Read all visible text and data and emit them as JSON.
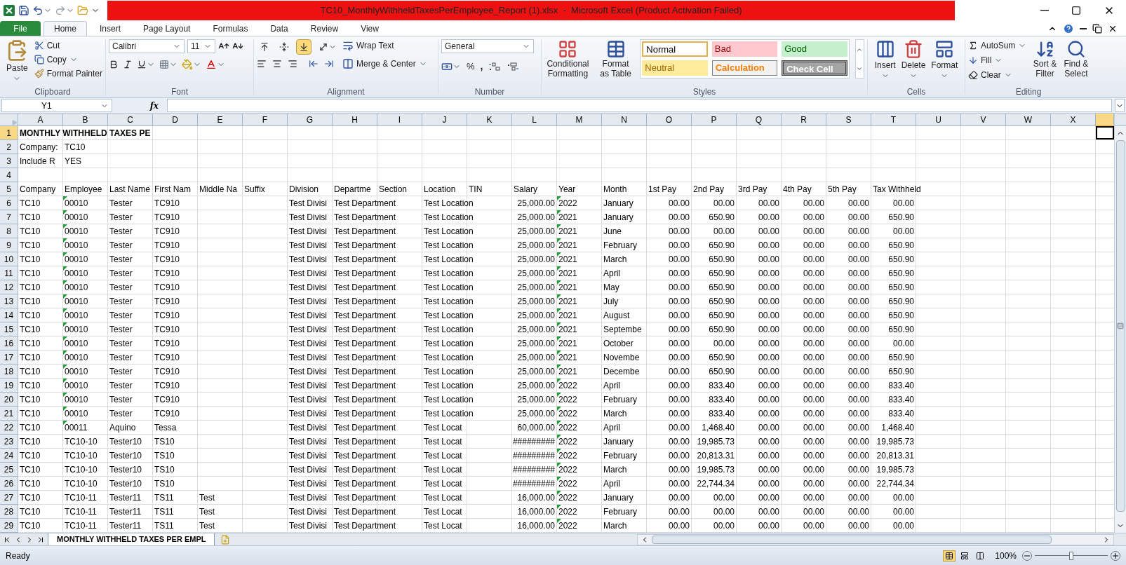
{
  "window": {
    "title": "TC10_MonthlyWithheldTaxesPerEmployee_Report (1).xlsx  -  Microsoft Excel (Product Activation Failed)"
  },
  "tabs": [
    {
      "label": "File",
      "kind": "file",
      "selected": false
    },
    {
      "label": "Home",
      "kind": "tab",
      "selected": true
    },
    {
      "label": "Insert",
      "kind": "tab",
      "selected": false
    },
    {
      "label": "Page Layout",
      "kind": "tab",
      "selected": false
    },
    {
      "label": "Formulas",
      "kind": "tab",
      "selected": false
    },
    {
      "label": "Data",
      "kind": "tab",
      "selected": false
    },
    {
      "label": "Review",
      "kind": "tab",
      "selected": false
    },
    {
      "label": "View",
      "kind": "tab",
      "selected": false
    }
  ],
  "ribbon": {
    "clipboard": {
      "label": "Clipboard",
      "paste": "Paste",
      "cut": "Cut",
      "copy": "Copy",
      "format_painter": "Format Painter"
    },
    "font": {
      "label": "Font",
      "font_name": "Calibri",
      "font_size": "11"
    },
    "alignment": {
      "label": "Alignment",
      "wrap_text": "Wrap Text",
      "merge_center": "Merge & Center",
      "vertical_align": [
        {
          "selected": false
        },
        {
          "selected": false
        },
        {
          "selected": true
        }
      ]
    },
    "number": {
      "label": "Number",
      "format": "General",
      "percent": "%",
      "comma": ","
    },
    "styles": {
      "label": "Styles",
      "conditional_formatting": "Conditional Formatting",
      "format_as_table": "Format as Table",
      "cell_styles": [
        {
          "label": "Normal",
          "kind": "normal"
        },
        {
          "label": "Bad",
          "kind": "bad"
        },
        {
          "label": "Good",
          "kind": "good"
        },
        {
          "label": "Neutral",
          "kind": "neutral"
        },
        {
          "label": "Calculation",
          "kind": "calculation"
        },
        {
          "label": "Check Cell",
          "kind": "check"
        }
      ]
    },
    "cells": {
      "label": "Cells",
      "insert": "Insert",
      "delete": "Delete",
      "format": "Format"
    },
    "editing": {
      "label": "Editing",
      "autosum": "AutoSum",
      "fill": "Fill",
      "clear": "Clear",
      "sort_filter": "Sort & Filter",
      "find_select": "Find & Select"
    }
  },
  "formula_bar": {
    "name_box": "Y1",
    "function_symbol": "fx"
  },
  "sheet": {
    "columns": [
      {
        "label": "A",
        "selected": false
      },
      {
        "label": "B",
        "selected": false
      },
      {
        "label": "C",
        "selected": false
      },
      {
        "label": "D",
        "selected": false
      },
      {
        "label": "E",
        "selected": false
      },
      {
        "label": "F",
        "selected": false
      },
      {
        "label": "G",
        "selected": false
      },
      {
        "label": "H",
        "selected": false
      },
      {
        "label": "I",
        "selected": false
      },
      {
        "label": "J",
        "selected": false
      },
      {
        "label": "K",
        "selected": false
      },
      {
        "label": "L",
        "selected": false
      },
      {
        "label": "M",
        "selected": false
      },
      {
        "label": "N",
        "selected": false
      },
      {
        "label": "O",
        "selected": false
      },
      {
        "label": "P",
        "selected": false
      },
      {
        "label": "Q",
        "selected": false
      },
      {
        "label": "R",
        "selected": false
      },
      {
        "label": "S",
        "selected": false
      },
      {
        "label": "T",
        "selected": false
      },
      {
        "label": "U",
        "selected": false
      },
      {
        "label": "V",
        "selected": false
      },
      {
        "label": "W",
        "selected": false
      },
      {
        "label": "X",
        "selected": false
      },
      {
        "selected": true
      }
    ],
    "rows": [
      {
        "number": "1",
        "kind": "title",
        "selected": true,
        "cells": [
          "MONTHLY WITHHELD TAXES PE"
        ]
      },
      {
        "number": "2",
        "kind": "info",
        "selected": false,
        "cells": [
          "Company:",
          "TC10"
        ]
      },
      {
        "number": "3",
        "kind": "info",
        "selected": false,
        "cells": [
          "Include R",
          "YES"
        ]
      },
      {
        "number": "4",
        "kind": "blank",
        "selected": false
      },
      {
        "number": "5",
        "kind": "header",
        "selected": false,
        "cells": [
          "Company",
          "Employee",
          "Last Name",
          "First Nam",
          "Middle Na",
          "Suffix",
          "Division",
          "Departme",
          "Section",
          "Location",
          "TIN",
          "Salary",
          "Year",
          "Month",
          "1st Pay",
          "2nd Pay",
          "3rd Pay",
          "4th Pay",
          "5th Pay",
          "Tax Withheld"
        ]
      },
      {
        "number": "6",
        "kind": "data",
        "selected": false,
        "cells": [
          "TC10",
          {
            "text": "00010",
            "warning": true
          },
          "Tester",
          "TC910",
          null,
          null,
          "Test Divisi",
          "Test Department",
          null,
          "Test Location",
          null,
          "25,000.00",
          {
            "text": "2022",
            "warning": true
          },
          "January",
          "00.00",
          "00.00",
          "00.00",
          "00.00",
          "00.00",
          "00.00"
        ]
      },
      {
        "number": "7",
        "kind": "data",
        "selected": false,
        "cells": [
          "TC10",
          {
            "text": "00010",
            "warning": true
          },
          "Tester",
          "TC910",
          null,
          null,
          "Test Divisi",
          "Test Department",
          null,
          "Test Location",
          null,
          "25,000.00",
          {
            "text": "2021",
            "warning": true
          },
          "January",
          "00.00",
          "650.90",
          "00.00",
          "00.00",
          "00.00",
          "650.90"
        ]
      },
      {
        "number": "8",
        "kind": "data",
        "selected": false,
        "cells": [
          "TC10",
          {
            "text": "00010",
            "warning": true
          },
          "Tester",
          "TC910",
          null,
          null,
          "Test Divisi",
          "Test Department",
          null,
          "Test Location",
          null,
          "25,000.00",
          {
            "text": "2021",
            "warning": true
          },
          "June",
          "00.00",
          "00.00",
          "00.00",
          "00.00",
          "00.00",
          "00.00"
        ]
      },
      {
        "number": "9",
        "kind": "data",
        "selected": false,
        "cells": [
          "TC10",
          {
            "text": "00010",
            "warning": true
          },
          "Tester",
          "TC910",
          null,
          null,
          "Test Divisi",
          "Test Department",
          null,
          "Test Location",
          null,
          "25,000.00",
          {
            "text": "2021",
            "warning": true
          },
          "February",
          "00.00",
          "650.90",
          "00.00",
          "00.00",
          "00.00",
          "650.90"
        ]
      },
      {
        "number": "10",
        "kind": "data",
        "selected": false,
        "cells": [
          "TC10",
          {
            "text": "00010",
            "warning": true
          },
          "Tester",
          "TC910",
          null,
          null,
          "Test Divisi",
          "Test Department",
          null,
          "Test Location",
          null,
          "25,000.00",
          {
            "text": "2021",
            "warning": true
          },
          "March",
          "00.00",
          "650.90",
          "00.00",
          "00.00",
          "00.00",
          "650.90"
        ]
      },
      {
        "number": "11",
        "kind": "data",
        "selected": false,
        "cells": [
          "TC10",
          {
            "text": "00010",
            "warning": true
          },
          "Tester",
          "TC910",
          null,
          null,
          "Test Divisi",
          "Test Department",
          null,
          "Test Location",
          null,
          "25,000.00",
          {
            "text": "2021",
            "warning": true
          },
          "April",
          "00.00",
          "650.90",
          "00.00",
          "00.00",
          "00.00",
          "650.90"
        ]
      },
      {
        "number": "12",
        "kind": "data",
        "selected": false,
        "cells": [
          "TC10",
          {
            "text": "00010",
            "warning": true
          },
          "Tester",
          "TC910",
          null,
          null,
          "Test Divisi",
          "Test Department",
          null,
          "Test Location",
          null,
          "25,000.00",
          {
            "text": "2021",
            "warning": true
          },
          "May",
          "00.00",
          "650.90",
          "00.00",
          "00.00",
          "00.00",
          "650.90"
        ]
      },
      {
        "number": "13",
        "kind": "data",
        "selected": false,
        "cells": [
          "TC10",
          {
            "text": "00010",
            "warning": true
          },
          "Tester",
          "TC910",
          null,
          null,
          "Test Divisi",
          "Test Department",
          null,
          "Test Location",
          null,
          "25,000.00",
          {
            "text": "2021",
            "warning": true
          },
          "July",
          "00.00",
          "650.90",
          "00.00",
          "00.00",
          "00.00",
          "650.90"
        ]
      },
      {
        "number": "14",
        "kind": "data",
        "selected": false,
        "cells": [
          "TC10",
          {
            "text": "00010",
            "warning": true
          },
          "Tester",
          "TC910",
          null,
          null,
          "Test Divisi",
          "Test Department",
          null,
          "Test Location",
          null,
          "25,000.00",
          {
            "text": "2021",
            "warning": true
          },
          "August",
          "00.00",
          "650.90",
          "00.00",
          "00.00",
          "00.00",
          "650.90"
        ]
      },
      {
        "number": "15",
        "kind": "data",
        "selected": false,
        "cells": [
          "TC10",
          {
            "text": "00010",
            "warning": true
          },
          "Tester",
          "TC910",
          null,
          null,
          "Test Divisi",
          "Test Department",
          null,
          "Test Location",
          null,
          "25,000.00",
          {
            "text": "2021",
            "warning": true
          },
          "Septembe",
          "00.00",
          "650.90",
          "00.00",
          "00.00",
          "00.00",
          "650.90"
        ]
      },
      {
        "number": "16",
        "kind": "data",
        "selected": false,
        "cells": [
          "TC10",
          {
            "text": "00010",
            "warning": true
          },
          "Tester",
          "TC910",
          null,
          null,
          "Test Divisi",
          "Test Department",
          null,
          "Test Location",
          null,
          "25,000.00",
          {
            "text": "2021",
            "warning": true
          },
          "October",
          "00.00",
          "00.00",
          "00.00",
          "00.00",
          "00.00",
          "00.00"
        ]
      },
      {
        "number": "17",
        "kind": "data",
        "selected": false,
        "cells": [
          "TC10",
          {
            "text": "00010",
            "warning": true
          },
          "Tester",
          "TC910",
          null,
          null,
          "Test Divisi",
          "Test Department",
          null,
          "Test Location",
          null,
          "25,000.00",
          {
            "text": "2021",
            "warning": true
          },
          "Novembe",
          "00.00",
          "650.90",
          "00.00",
          "00.00",
          "00.00",
          "650.90"
        ]
      },
      {
        "number": "18",
        "kind": "data",
        "selected": false,
        "cells": [
          "TC10",
          {
            "text": "00010",
            "warning": true
          },
          "Tester",
          "TC910",
          null,
          null,
          "Test Divisi",
          "Test Department",
          null,
          "Test Location",
          null,
          "25,000.00",
          {
            "text": "2021",
            "warning": true
          },
          "Decembe",
          "00.00",
          "650.90",
          "00.00",
          "00.00",
          "00.00",
          "650.90"
        ]
      },
      {
        "number": "19",
        "kind": "data",
        "selected": false,
        "cells": [
          "TC10",
          {
            "text": "00010",
            "warning": true
          },
          "Tester",
          "TC910",
          null,
          null,
          "Test Divisi",
          "Test Department",
          null,
          "Test Location",
          null,
          "25,000.00",
          {
            "text": "2022",
            "warning": true
          },
          "April",
          "00.00",
          "833.40",
          "00.00",
          "00.00",
          "00.00",
          "833.40"
        ]
      },
      {
        "number": "20",
        "kind": "data",
        "selected": false,
        "cells": [
          "TC10",
          {
            "text": "00010",
            "warning": true
          },
          "Tester",
          "TC910",
          null,
          null,
          "Test Divisi",
          "Test Department",
          null,
          "Test Location",
          null,
          "25,000.00",
          {
            "text": "2022",
            "warning": true
          },
          "February",
          "00.00",
          "833.40",
          "00.00",
          "00.00",
          "00.00",
          "833.40"
        ]
      },
      {
        "number": "21",
        "kind": "data",
        "selected": false,
        "cells": [
          "TC10",
          {
            "text": "00010",
            "warning": true
          },
          "Tester",
          "TC910",
          null,
          null,
          "Test Divisi",
          "Test Department",
          null,
          "Test Location",
          null,
          "25,000.00",
          {
            "text": "2022",
            "warning": true
          },
          "March",
          "00.00",
          "833.40",
          "00.00",
          "00.00",
          "00.00",
          "833.40"
        ]
      },
      {
        "number": "22",
        "kind": "data",
        "selected": false,
        "cells": [
          "TC10",
          {
            "text": "00011",
            "warning": true
          },
          "Aquino",
          "Tessa",
          null,
          null,
          "Test Divisi",
          "Test Department",
          null,
          "Test Locat",
          null,
          "60,000.00",
          {
            "text": "2022",
            "warning": true
          },
          "April",
          "00.00",
          "1,468.40",
          "00.00",
          "00.00",
          "00.00",
          "1,468.40"
        ]
      },
      {
        "number": "23",
        "kind": "data",
        "selected": false,
        "cells": [
          "TC10",
          "TC10-10",
          "Tester10",
          "TS10",
          null,
          null,
          "Test Divisi",
          "Test Department",
          null,
          "Test Locat",
          null,
          "#########",
          {
            "text": "2022",
            "warning": true
          },
          "January",
          "00.00",
          "19,985.73",
          "00.00",
          "00.00",
          "00.00",
          "19,985.73"
        ]
      },
      {
        "number": "24",
        "kind": "data",
        "selected": false,
        "cells": [
          "TC10",
          "TC10-10",
          "Tester10",
          "TS10",
          null,
          null,
          "Test Divisi",
          "Test Department",
          null,
          "Test Locat",
          null,
          "#########",
          {
            "text": "2022",
            "warning": true
          },
          "February",
          "00.00",
          "20,813.31",
          "00.00",
          "00.00",
          "00.00",
          "20,813.31"
        ]
      },
      {
        "number": "25",
        "kind": "data",
        "selected": false,
        "cells": [
          "TC10",
          "TC10-10",
          "Tester10",
          "TS10",
          null,
          null,
          "Test Divisi",
          "Test Department",
          null,
          "Test Locat",
          null,
          "#########",
          {
            "text": "2022",
            "warning": true
          },
          "March",
          "00.00",
          "19,985.73",
          "00.00",
          "00.00",
          "00.00",
          "19,985.73"
        ]
      },
      {
        "number": "26",
        "kind": "data",
        "selected": false,
        "cells": [
          "TC10",
          "TC10-10",
          "Tester10",
          "TS10",
          null,
          null,
          "Test Divisi",
          "Test Department",
          null,
          "Test Locat",
          null,
          "#########",
          {
            "text": "2022",
            "warning": true
          },
          "April",
          "00.00",
          "22,744.34",
          "00.00",
          "00.00",
          "00.00",
          "22,744.34"
        ]
      },
      {
        "number": "27",
        "kind": "data",
        "selected": false,
        "cells": [
          "TC10",
          "TC10-11",
          "Tester11",
          "TS11",
          "Test",
          null,
          "Test Divisi",
          "Test Department",
          null,
          "Test Locat",
          null,
          "16,000.00",
          {
            "text": "2022",
            "warning": true
          },
          "January",
          "00.00",
          "00.00",
          "00.00",
          "00.00",
          "00.00",
          "00.00"
        ]
      },
      {
        "number": "28",
        "kind": "data",
        "selected": false,
        "cells": [
          "TC10",
          "TC10-11",
          "Tester11",
          "TS11",
          "Test",
          null,
          "Test Divisi",
          "Test Department",
          null,
          "Test Locat",
          null,
          "16,000.00",
          {
            "text": "2022",
            "warning": true
          },
          "February",
          "00.00",
          "00.00",
          "00.00",
          "00.00",
          "00.00",
          "00.00"
        ]
      },
      {
        "number": "29",
        "kind": "data",
        "selected": false,
        "cells": [
          "TC10",
          "TC10-11",
          "Tester11",
          "TS11",
          "Test",
          null,
          "Test Divisi",
          "Test Department",
          null,
          "Test Locat",
          null,
          "16,000.00",
          {
            "text": "2022",
            "warning": true
          },
          "March",
          "00.00",
          "00.00",
          "00.00",
          "00.00",
          "00.00",
          "00.00"
        ]
      }
    ]
  },
  "sheet_tabs": [
    {
      "label": "MONTHLY WITHHELD TAXES PER EMPL",
      "selected": true
    }
  ],
  "status_bar": {
    "status": "Ready",
    "views": [
      {
        "selected": true
      },
      {
        "selected": false
      },
      {
        "selected": false
      }
    ],
    "zoom": {
      "label": "100%",
      "level": 0.5
    }
  }
}
